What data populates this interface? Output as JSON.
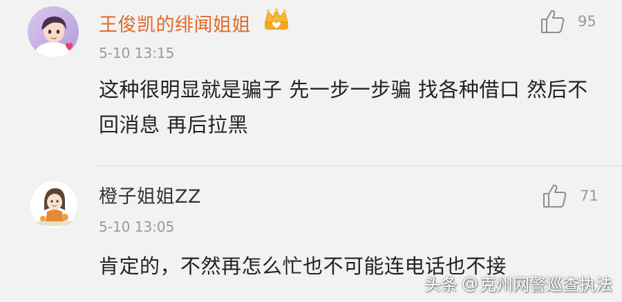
{
  "comments": [
    {
      "username": "王俊凯的绯闻姐姐",
      "timestamp": "5-10 13:15",
      "text": "这种很明显就是骗子 先一步一步骗 找各种借口 然后不回消息 再后拉黑",
      "likes": "95",
      "avatar_icon": "avatar-anime-boy-icon",
      "badge_icon": "vip-crown-icon",
      "username_color": "#e2692b"
    },
    {
      "username": "橙子姐姐ZZ",
      "timestamp": "5-10 13:05",
      "text": "肯定的，不然再怎么忙也不可能连电话也不接",
      "likes": "71",
      "avatar_icon": "avatar-cartoon-girl-icon",
      "username_color": "#333333"
    }
  ],
  "watermark": {
    "prefix": "头条",
    "at": "@",
    "account": "克州网警巡查执法"
  },
  "colors": {
    "background": "#f2f2f2",
    "muted_text": "#9a9a9a",
    "body_text": "#222222"
  }
}
